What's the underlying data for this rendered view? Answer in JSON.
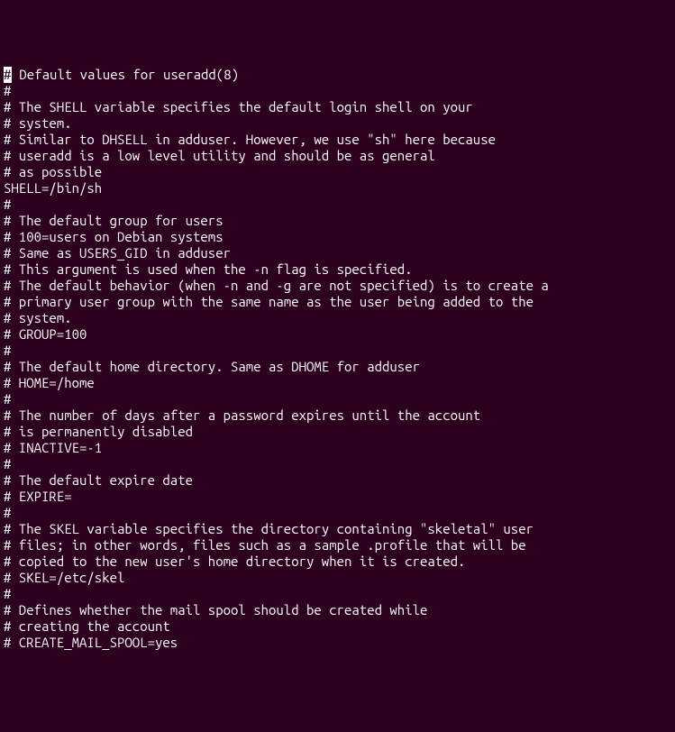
{
  "lines": [
    {
      "cursor": true,
      "text": " Default values for useradd(8)"
    },
    {
      "text": "#"
    },
    {
      "text": "# The SHELL variable specifies the default login shell on your"
    },
    {
      "text": "# system."
    },
    {
      "text": "# Similar to DHSELL in adduser. However, we use \"sh\" here because"
    },
    {
      "text": "# useradd is a low level utility and should be as general"
    },
    {
      "text": "# as possible"
    },
    {
      "text": "SHELL=/bin/sh"
    },
    {
      "text": "#"
    },
    {
      "text": "# The default group for users"
    },
    {
      "text": "# 100=users on Debian systems"
    },
    {
      "text": "# Same as USERS_GID in adduser"
    },
    {
      "text": "# This argument is used when the -n flag is specified."
    },
    {
      "text": "# The default behavior (when -n and -g are not specified) is to create a"
    },
    {
      "text": "# primary user group with the same name as the user being added to the"
    },
    {
      "text": "# system."
    },
    {
      "text": "# GROUP=100"
    },
    {
      "text": "#"
    },
    {
      "text": "# The default home directory. Same as DHOME for adduser"
    },
    {
      "text": "# HOME=/home"
    },
    {
      "text": "#"
    },
    {
      "text": "# The number of days after a password expires until the account"
    },
    {
      "text": "# is permanently disabled"
    },
    {
      "text": "# INACTIVE=-1"
    },
    {
      "text": "#"
    },
    {
      "text": "# The default expire date"
    },
    {
      "text": "# EXPIRE="
    },
    {
      "text": "#"
    },
    {
      "text": "# The SKEL variable specifies the directory containing \"skeletal\" user"
    },
    {
      "text": "# files; in other words, files such as a sample .profile that will be"
    },
    {
      "text": "# copied to the new user's home directory when it is created."
    },
    {
      "text": "# SKEL=/etc/skel"
    },
    {
      "text": "#"
    },
    {
      "text": "# Defines whether the mail spool should be created while"
    },
    {
      "text": "# creating the account"
    },
    {
      "text": "# CREATE_MAIL_SPOOL=yes"
    }
  ]
}
